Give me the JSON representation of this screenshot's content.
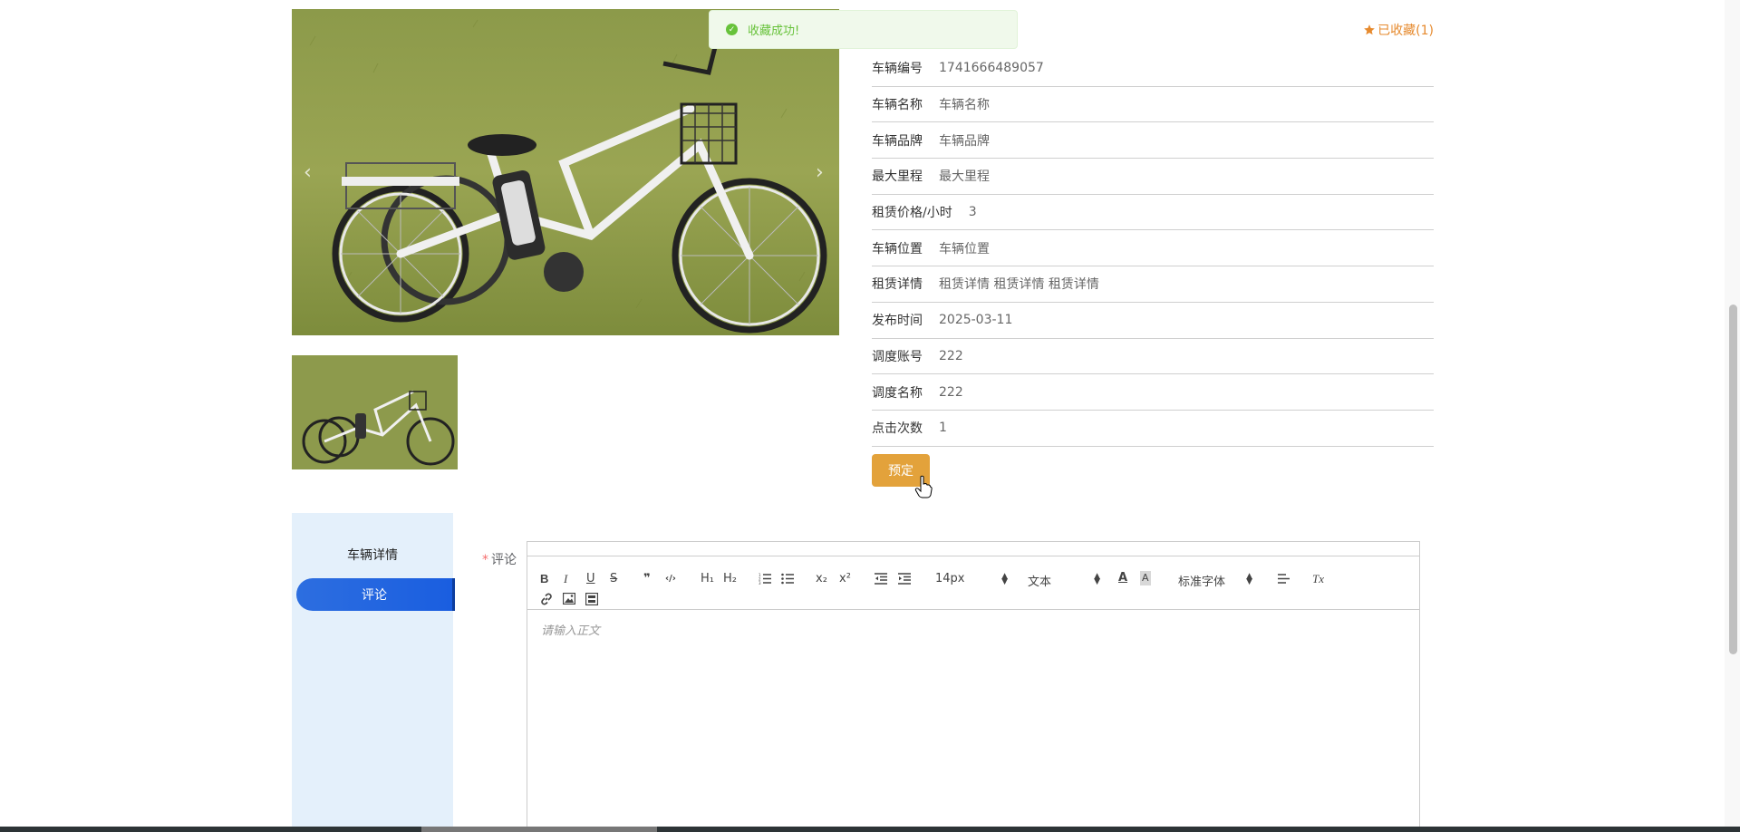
{
  "toast": {
    "message": "收藏成功!",
    "icon": "check-circle-icon",
    "color": "#67c23a"
  },
  "favorite": {
    "label": "已收藏(1)",
    "icon": "star-icon",
    "color": "#e68a2e"
  },
  "info": [
    {
      "label": "车辆编号",
      "value": "1741666489057"
    },
    {
      "label": "车辆名称",
      "value": "车辆名称"
    },
    {
      "label": "车辆品牌",
      "value": "车辆品牌"
    },
    {
      "label": "最大里程",
      "value": "最大里程"
    },
    {
      "label": "租赁价格/小时",
      "value": "3"
    },
    {
      "label": "车辆位置",
      "value": "车辆位置"
    },
    {
      "label": "租赁详情",
      "value": "租赁详情 租赁详情 租赁详情"
    },
    {
      "label": "发布时间",
      "value": "2025-03-11"
    },
    {
      "label": "调度账号",
      "value": "222"
    },
    {
      "label": "调度名称",
      "value": "222"
    },
    {
      "label": "点击次数",
      "value": "1"
    }
  ],
  "book_button": {
    "label": "预定",
    "color": "#e3a23b"
  },
  "tabs": [
    {
      "label": "车辆详情",
      "active": false
    },
    {
      "label": "评论",
      "active": true
    }
  ],
  "comment": {
    "required_mark": "*",
    "label": "评论",
    "placeholder": "请输入正文"
  },
  "toolbar": {
    "bold": "B",
    "italic": "I",
    "underline": "U",
    "strike": "S",
    "quote": "❞",
    "code": "‹/›",
    "h1": "H₁",
    "h2": "H₂",
    "sub": "x₂",
    "sup": "x²",
    "font_size": "14px",
    "header_select": "文本",
    "font_family": "标准字体",
    "clean": "Tx"
  }
}
